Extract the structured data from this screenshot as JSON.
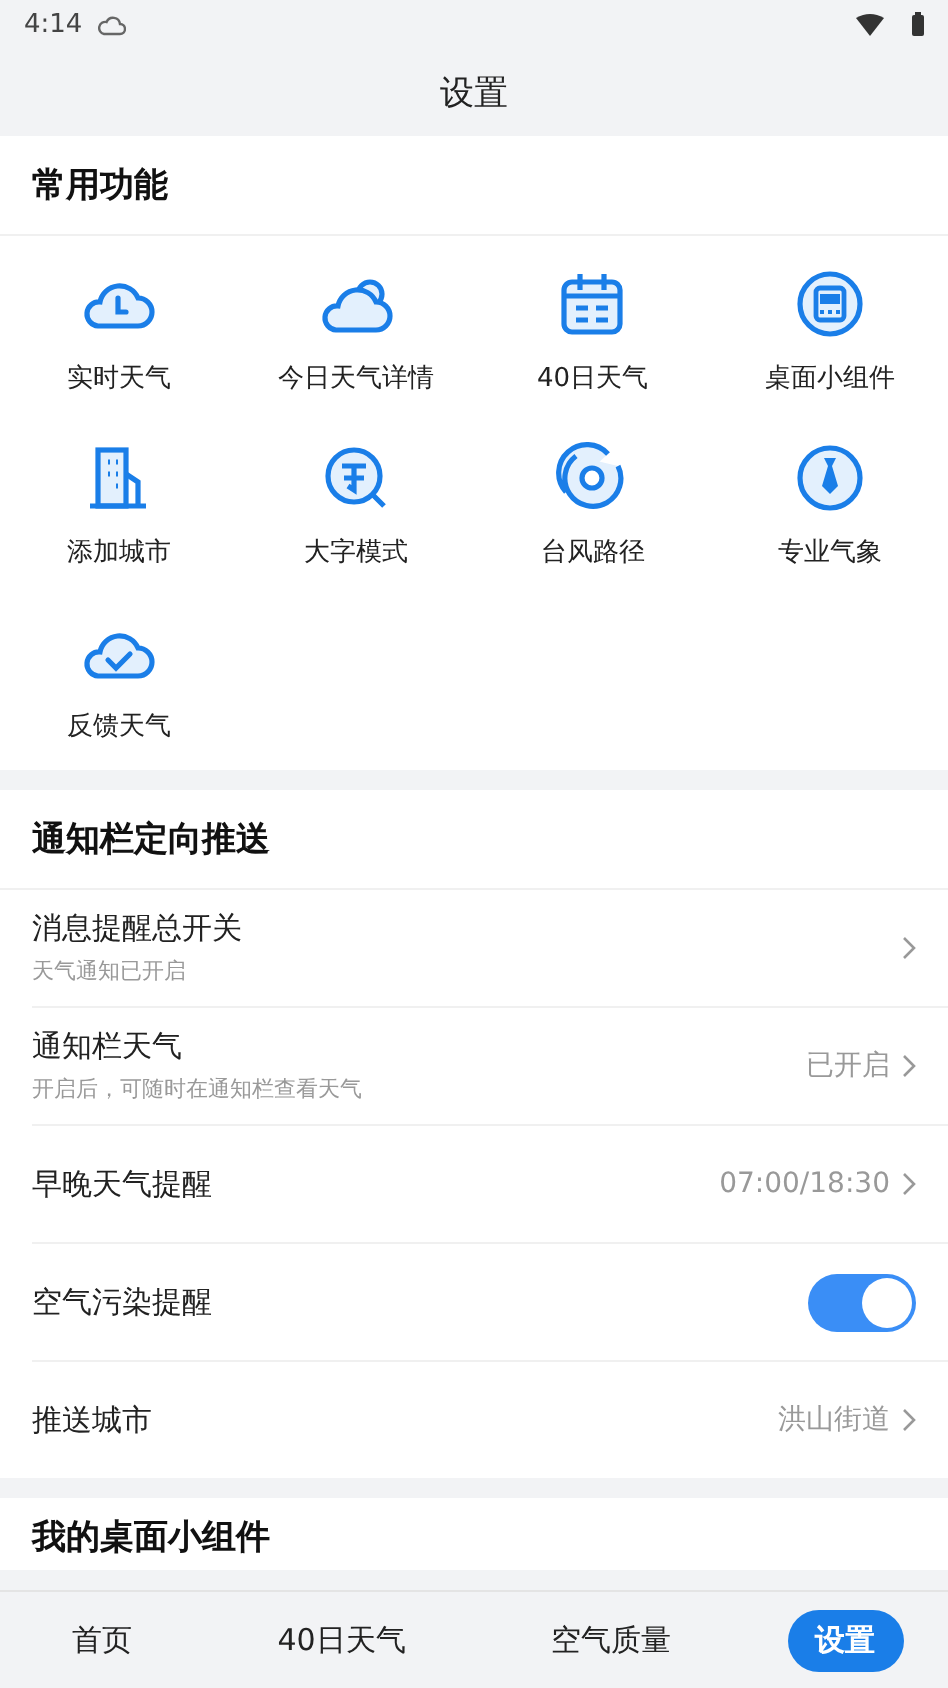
{
  "status_bar": {
    "time": "4:14"
  },
  "title": "设置",
  "common": {
    "title": "常用功能",
    "items": [
      {
        "label": "实时天气"
      },
      {
        "label": "今日天气详情"
      },
      {
        "label": "40日天气"
      },
      {
        "label": "桌面小组件"
      },
      {
        "label": "添加城市"
      },
      {
        "label": "大字模式"
      },
      {
        "label": "台风路径"
      },
      {
        "label": "专业气象"
      },
      {
        "label": "反馈天气"
      }
    ]
  },
  "push": {
    "title": "通知栏定向推送",
    "rows": [
      {
        "kind": "nav",
        "label": "消息提醒总开关",
        "subtitle": "天气通知已开启"
      },
      {
        "kind": "nav",
        "label": "通知栏天气",
        "subtitle": "开启后，可随时在通知栏查看天气",
        "value": "已开启"
      },
      {
        "kind": "nav",
        "label": "早晚天气提醒",
        "value": "07:00/18:30"
      },
      {
        "kind": "toggle",
        "label": "空气污染提醒",
        "on": true
      },
      {
        "kind": "nav",
        "label": "推送城市",
        "value": "洪山街道"
      }
    ]
  },
  "widgets": {
    "title": "我的桌面小组件"
  },
  "tabs": [
    {
      "label": "首页",
      "selected": false
    },
    {
      "label": "40日天气",
      "selected": false
    },
    {
      "label": "空气质量",
      "selected": false
    },
    {
      "label": "设置",
      "selected": true
    }
  ]
}
